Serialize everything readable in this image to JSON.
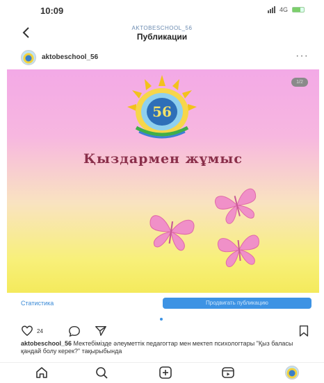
{
  "status_bar": {
    "time": "10:09",
    "network": "4G"
  },
  "nav": {
    "account_handle": "AKTOBESCHOOL_56",
    "title": "Публикации"
  },
  "post": {
    "username": "aktobeschool_56",
    "image_counter": "1/2",
    "logo_text": "56",
    "headline": "Қыздармен жұмыс",
    "likes": "24",
    "caption_user": "aktobeschool_56",
    "caption_text": "Мектебімізде әлеуметтік педагогтар мен мектеп психологтары \"Қыз баласы қандай болу керек?\" тақырыбында"
  },
  "actions": {
    "statistics_label": "Статистика",
    "promote_label": "Продвигать публикацию"
  },
  "icons": {
    "back": "back-icon",
    "more": "more-icon",
    "like": "heart-icon",
    "comment": "comment-icon",
    "share": "send-icon",
    "save": "bookmark-icon",
    "home": "home-icon",
    "search": "search-icon",
    "create": "add-icon",
    "reels": "reels-icon",
    "profile": "profile-avatar"
  },
  "colors": {
    "accent": "#3d93e4",
    "headline": "#8a2f4a",
    "butterfly": "#f08dc8"
  }
}
